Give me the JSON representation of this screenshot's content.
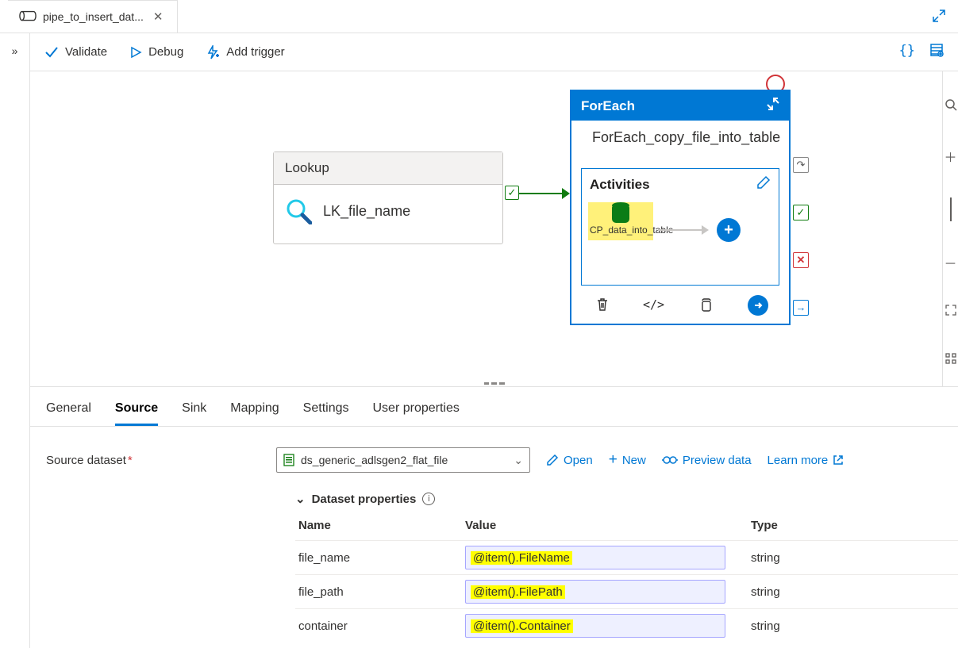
{
  "tab": {
    "title": "pipe_to_insert_dat..."
  },
  "toolbar": {
    "validate": "Validate",
    "debug": "Debug",
    "add_trigger": "Add trigger"
  },
  "canvas": {
    "lookup_header": "Lookup",
    "lookup_name": "LK_file_name",
    "foreach_header": "ForEach",
    "foreach_name": "ForEach_copy_file_into_table",
    "activities_label": "Activities",
    "copy_activity": "CP_data_into_table"
  },
  "panel": {
    "tabs": {
      "general": "General",
      "source": "Source",
      "sink": "Sink",
      "mapping": "Mapping",
      "settings": "Settings",
      "user_props": "User properties"
    },
    "source_dataset_label": "Source dataset",
    "dataset_value": "ds_generic_adlsgen2_flat_file",
    "open": "Open",
    "new": "New",
    "preview": "Preview data",
    "learn_more": "Learn more",
    "dp_header": "Dataset properties",
    "cols": {
      "name": "Name",
      "value": "Value",
      "type": "Type"
    },
    "rows": [
      {
        "name": "file_name",
        "value": "@item().FileName",
        "type": "string"
      },
      {
        "name": "file_path",
        "value": "@item().FilePath",
        "type": "string"
      },
      {
        "name": "container",
        "value": "@item().Container",
        "type": "string"
      }
    ]
  }
}
